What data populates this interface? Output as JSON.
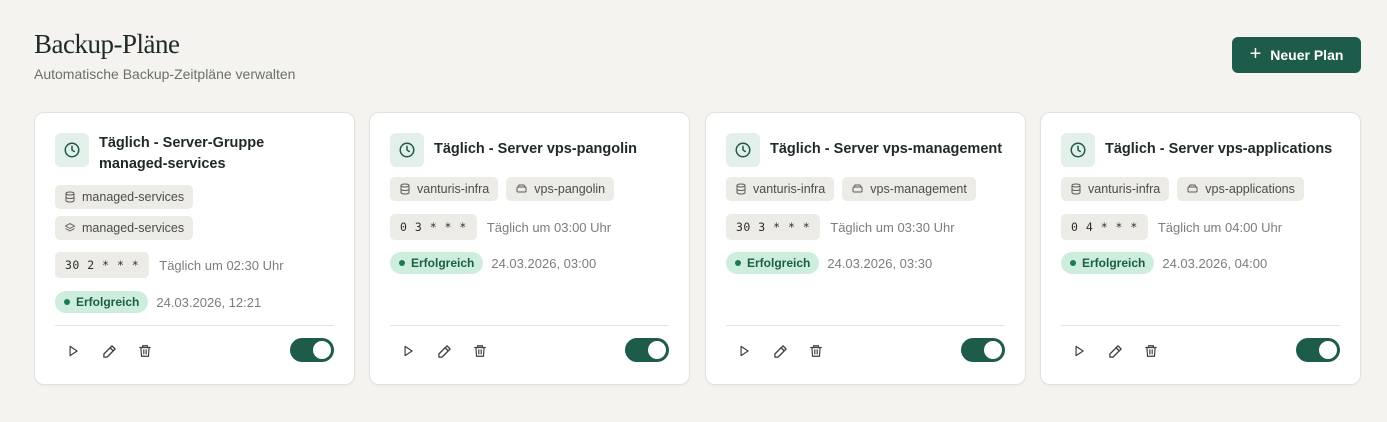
{
  "header": {
    "title": "Backup-Pläne",
    "subtitle": "Automatische Backup-Zeitpläne verwalten",
    "new_plan_label": "Neuer Plan"
  },
  "colors": {
    "accent": "#1d5c4a",
    "success_bg": "#cdeedd",
    "success_text": "#1b5e43"
  },
  "cards": [
    {
      "title": "Täglich - Server-Gruppe managed-services",
      "tags": [
        {
          "icon": "database-icon",
          "label": "managed-services"
        },
        {
          "icon": "layers-icon",
          "label": "managed-services"
        }
      ],
      "cron": "30 2 * * *",
      "cron_desc": "Täglich um 02:30 Uhr",
      "status": "Erfolgreich",
      "status_time": "24.03.2026, 12:21",
      "enabled": true
    },
    {
      "title": "Täglich - Server vps-pangolin",
      "tags": [
        {
          "icon": "database-icon",
          "label": "vanturis-infra"
        },
        {
          "icon": "server-icon",
          "label": "vps-pangolin"
        }
      ],
      "cron": "0 3 * * *",
      "cron_desc": "Täglich um 03:00 Uhr",
      "status": "Erfolgreich",
      "status_time": "24.03.2026, 03:00",
      "enabled": true
    },
    {
      "title": "Täglich - Server vps-management",
      "tags": [
        {
          "icon": "database-icon",
          "label": "vanturis-infra"
        },
        {
          "icon": "server-icon",
          "label": "vps-management"
        }
      ],
      "cron": "30 3 * * *",
      "cron_desc": "Täglich um 03:30 Uhr",
      "status": "Erfolgreich",
      "status_time": "24.03.2026, 03:30",
      "enabled": true
    },
    {
      "title": "Täglich - Server vps-applications",
      "tags": [
        {
          "icon": "database-icon",
          "label": "vanturis-infra"
        },
        {
          "icon": "server-icon",
          "label": "vps-applications"
        }
      ],
      "cron": "0 4 * * *",
      "cron_desc": "Täglich um 04:00 Uhr",
      "status": "Erfolgreich",
      "status_time": "24.03.2026, 04:00",
      "enabled": true
    }
  ]
}
